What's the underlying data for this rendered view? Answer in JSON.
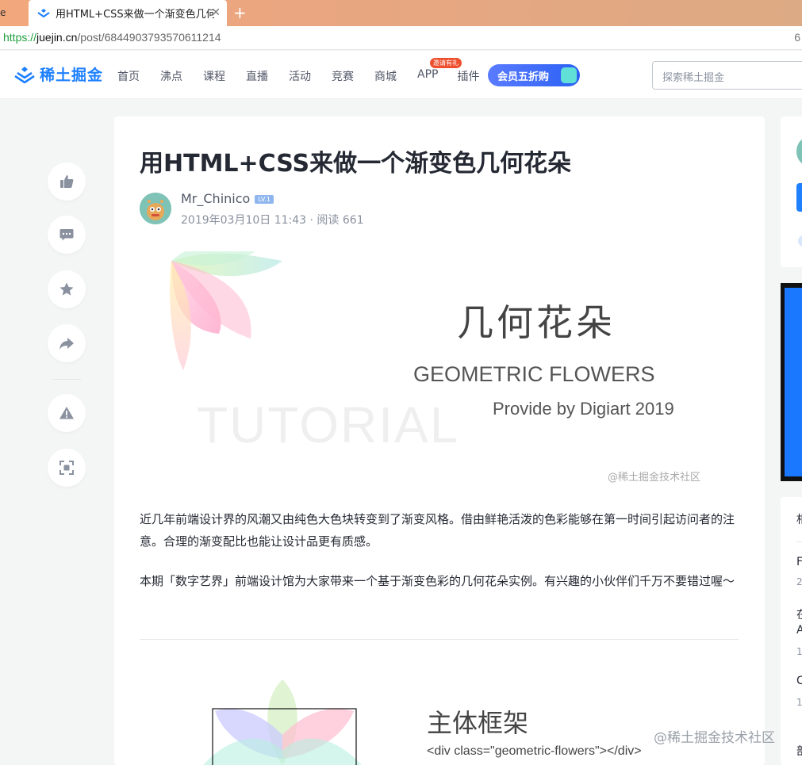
{
  "browser": {
    "prev_tab_title": "e",
    "active_tab_title": "用HTML+CSS来做一个渐变色几何花",
    "url_scheme": "https://",
    "url_host": "juejin.cn",
    "url_path": "/post/6844903793570611214",
    "addr_right_char": "6"
  },
  "header": {
    "logo_text": "稀土掘金",
    "nav": [
      "首页",
      "沸点",
      "课程",
      "直播",
      "活动",
      "竞赛",
      "商城",
      "APP",
      "插件"
    ],
    "app_badge": "邀请有礼",
    "vip_label": "会员五折购",
    "search_placeholder": "探索稀土掘金"
  },
  "article": {
    "title": "用HTML+CSS来做一个渐变色几何花朵",
    "author": "Mr_Chinico",
    "author_level": "LV.1",
    "date": "2019年03月10日 11:43",
    "reads": "阅读 661",
    "meta_sep": "·",
    "cover": {
      "title_cn": "几何花朵",
      "title_en": "GEOMETRIC FLOWERS",
      "byline": "Provide by Digiart 2019",
      "bg_word": "TUTORIAL",
      "watermark": "@稀土掘金技术社区"
    },
    "paragraphs": [
      "近几年前端设计界的风潮又由纯色大色块转变到了渐变风格。借由鲜艳活泼的色彩能够在第一时间引起访问者的注意。合理的渐变配比也能让设计品更有质感。",
      "本期「数字艺界」前端设计馆为大家带来一个基于渐变色彩的几何花朵实例。有兴趣的小伙伴们千万不要错过喔～"
    ],
    "section": {
      "title": "主体框架",
      "code": "<div class=\"geometric-flowers\"></div>",
      "watermark": "@稀土掘金技术社区"
    }
  },
  "right": {
    "items": [
      "相",
      "F",
      "2",
      "在",
      "A",
      "1",
      "C",
      "1",
      "部"
    ]
  },
  "colors": {
    "brand": "#1e80ff",
    "text": "#252933",
    "muted": "#8a919f",
    "page_bg": "#f4f5f5"
  }
}
